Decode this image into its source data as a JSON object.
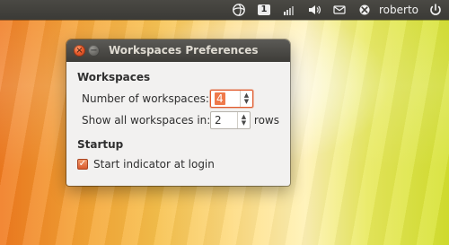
{
  "desktop": {
    "panel": {
      "workspace_badge": "1",
      "username": "roberto"
    }
  },
  "window": {
    "title": "Workspaces Preferences",
    "sections": {
      "workspaces": {
        "title": "Workspaces",
        "number_label": "Number of workspaces:",
        "number_value": "4",
        "show_all_label": "Show all workspaces in:",
        "show_all_value": "2",
        "show_all_suffix": "rows"
      },
      "startup": {
        "title": "Startup",
        "start_indicator_label": "Start indicator at login",
        "start_indicator_checked": true
      }
    }
  },
  "icons": {
    "panel_icons": [
      "ubuntu-one-icon",
      "workspace-indicator-icon",
      "network-signal-icon",
      "volume-icon",
      "messaging-icon",
      "user-status-icon",
      "power-icon"
    ]
  },
  "colors": {
    "accent": "#e05a2c",
    "panel_bg": "#3b3a36"
  }
}
